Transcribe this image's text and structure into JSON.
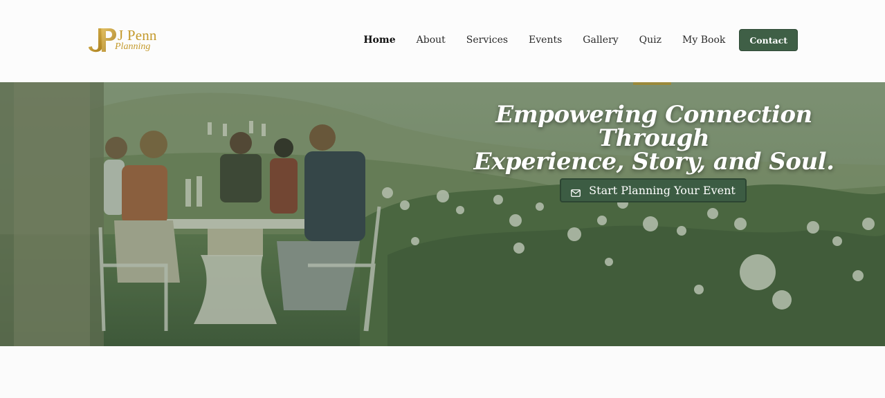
{
  "brand": {
    "name": "J Penn",
    "tagline": "Planning",
    "accent_color": "#c49a2c"
  },
  "nav": {
    "items": [
      {
        "label": "Home",
        "active": true
      },
      {
        "label": "About",
        "active": false
      },
      {
        "label": "Services",
        "active": false
      },
      {
        "label": "Events",
        "active": false
      },
      {
        "label": "Gallery",
        "active": false
      },
      {
        "label": "Quiz",
        "active": false
      },
      {
        "label": "My Book",
        "active": false
      }
    ],
    "contact_label": "Contact",
    "button_color": "#3f5f46"
  },
  "hero": {
    "title_line1": "Empowering Connection Through",
    "title_line2": "Experience, Story, and Soul.",
    "cta_label": "Start Planning Your Event",
    "cta_icon": "mail-icon",
    "image_description_icon": "hero-photo"
  }
}
